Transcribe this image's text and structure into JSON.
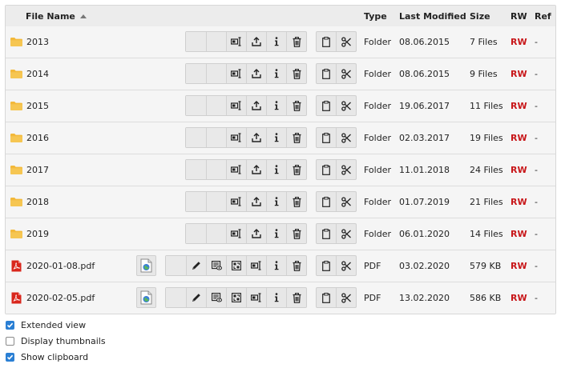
{
  "header": {
    "name": "File Name",
    "type": "Type",
    "modified": "Last Modified",
    "size": "Size",
    "rw": "RW",
    "ref": "Ref"
  },
  "rows": [
    {
      "name": "2013",
      "type": "Folder",
      "modified": "08.06.2015",
      "size": "7 Files",
      "rw": "RW",
      "ref": "-",
      "icon": "folder-icon"
    },
    {
      "name": "2014",
      "type": "Folder",
      "modified": "08.06.2015",
      "size": "9 Files",
      "rw": "RW",
      "ref": "-",
      "icon": "folder-icon"
    },
    {
      "name": "2015",
      "type": "Folder",
      "modified": "19.06.2017",
      "size": "11 Files",
      "rw": "RW",
      "ref": "-",
      "icon": "folder-icon"
    },
    {
      "name": "2016",
      "type": "Folder",
      "modified": "02.03.2017",
      "size": "19 Files",
      "rw": "RW",
      "ref": "-",
      "icon": "folder-icon"
    },
    {
      "name": "2017",
      "type": "Folder",
      "modified": "11.01.2018",
      "size": "24 Files",
      "rw": "RW",
      "ref": "-",
      "icon": "folder-icon"
    },
    {
      "name": "2018",
      "type": "Folder",
      "modified": "01.07.2019",
      "size": "21 Files",
      "rw": "RW",
      "ref": "-",
      "icon": "folder-icon"
    },
    {
      "name": "2019",
      "type": "Folder",
      "modified": "06.01.2020",
      "size": "14 Files",
      "rw": "RW",
      "ref": "-",
      "icon": "folder-icon"
    },
    {
      "name": "2020-01-08.pdf",
      "type": "PDF",
      "modified": "03.02.2020",
      "size": "579 KB",
      "rw": "RW",
      "ref": "-",
      "icon": "pdf-icon"
    },
    {
      "name": "2020-02-05.pdf",
      "type": "PDF",
      "modified": "13.02.2020",
      "size": "586 KB",
      "rw": "RW",
      "ref": "-",
      "icon": "pdf-icon"
    }
  ],
  "options": {
    "extended_view": {
      "label": "Extended view",
      "checked": true
    },
    "thumbnails": {
      "label": "Display thumbnails",
      "checked": false
    },
    "clipboard": {
      "label": "Show clipboard",
      "checked": true
    }
  },
  "colors": {
    "rw": "#c8171a",
    "folder": "#f3b93a",
    "pdf": "#d9261c",
    "checkbox": "#2a7fd4"
  }
}
